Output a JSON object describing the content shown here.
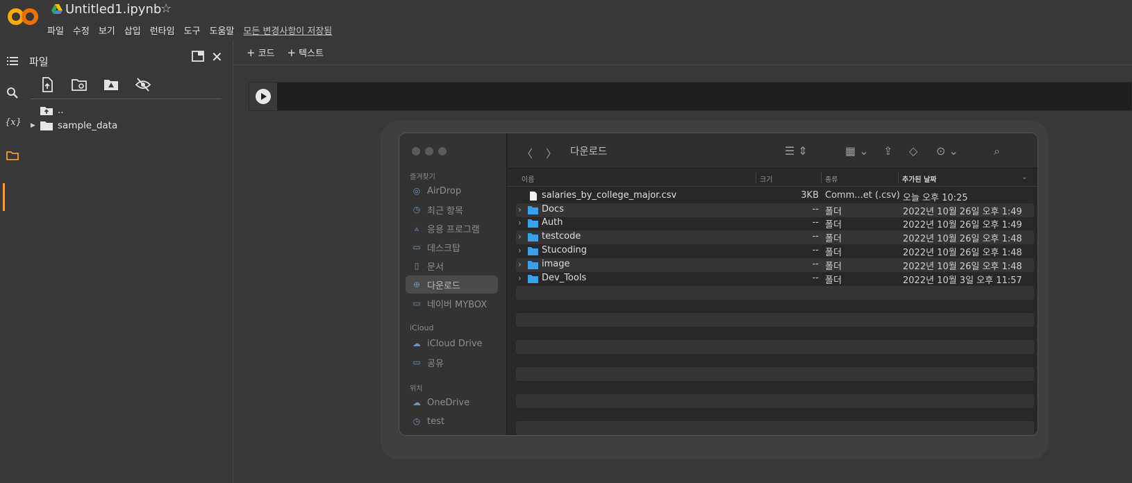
{
  "app": {
    "logo_text": "CO",
    "title": "Untitled1.ipynb",
    "menu": [
      "파일",
      "수정",
      "보기",
      "삽입",
      "런타임",
      "도구",
      "도움말"
    ],
    "save_status": "모든 변경사항이 저장됨"
  },
  "files_panel": {
    "title": "파일",
    "tree": [
      {
        "label": ".."
      },
      {
        "label": "sample_data"
      }
    ]
  },
  "notebook": {
    "add_code": "코드",
    "add_text": "텍스트"
  },
  "finder": {
    "location": "다운로드",
    "sidebar": {
      "favorites_header": "즐겨찾기",
      "favorites": [
        "AirDrop",
        "최근 항목",
        "응용 프로그램",
        "데스크탑",
        "문서",
        "다운로드",
        "네이버 MYBOX"
      ],
      "icloud_header": "iCloud",
      "icloud": [
        "iCloud Drive",
        "공유"
      ],
      "locations_header": "위치",
      "locations": [
        "OneDrive",
        "test"
      ]
    },
    "columns": {
      "name": "이름",
      "size": "크기",
      "kind": "종류",
      "date": "추가된 날짜"
    },
    "rows": [
      {
        "name": "salaries_by_college_major.csv",
        "size": "3KB",
        "kind": "Comm...et (.csv)",
        "date": "오늘 오후 10:25"
      },
      {
        "name": "Docs",
        "size": "--",
        "kind": "폴더",
        "date": "2022년 10월 26일 오후 1:49"
      },
      {
        "name": "Auth",
        "size": "--",
        "kind": "폴더",
        "date": "2022년 10월 26일 오후 1:49"
      },
      {
        "name": "testcode",
        "size": "--",
        "kind": "폴더",
        "date": "2022년 10월 26일 오후 1:48"
      },
      {
        "name": "Stucoding",
        "size": "--",
        "kind": "폴더",
        "date": "2022년 10월 26일 오후 1:48"
      },
      {
        "name": "image",
        "size": "--",
        "kind": "폴더",
        "date": "2022년 10월 26일 오후 1:48"
      },
      {
        "name": "Dev_Tools",
        "size": "--",
        "kind": "폴더",
        "date": "2022년 10월 3일 오후 11:57"
      }
    ]
  },
  "colors": {
    "accent_orange": "#f29d38",
    "folder_blue": "#3aa0e8",
    "background": "#383838"
  }
}
